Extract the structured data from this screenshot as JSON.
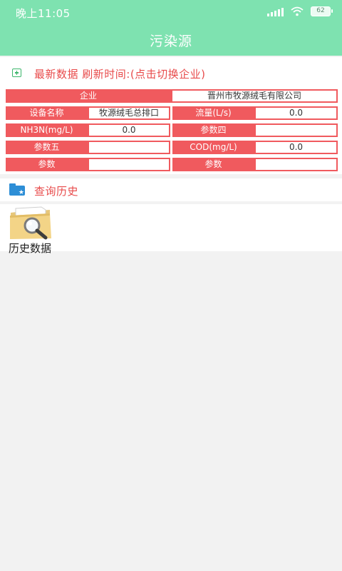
{
  "status_bar": {
    "time": "晚上11:05",
    "battery": "62"
  },
  "header": {
    "title": "污染源"
  },
  "latest": {
    "heading": "最新数据 刷新时间:(点击切换企业)",
    "company_label": "企业",
    "company_value": "晋州市牧源绒毛有限公司",
    "rows": [
      {
        "l1": "设备名称",
        "v1": "牧源绒毛总排口",
        "l2": "流量(L/s)",
        "v2": "0.0"
      },
      {
        "l1": "NH3N(mg/L)",
        "v1": "0.0",
        "l2": "参数四",
        "v2": ""
      },
      {
        "l1": "参数五",
        "v1": "",
        "l2": "COD(mg/L)",
        "v2": "0.0"
      },
      {
        "l1": "参数",
        "v1": "",
        "l2": "参数",
        "v2": ""
      }
    ]
  },
  "history": {
    "heading": "查询历史",
    "items": [
      {
        "label": "历史数据",
        "icon": "folder-search-icon"
      }
    ]
  },
  "colors": {
    "accent": "#7ee2b0",
    "label_red": "#f05a5e",
    "title_red": "#e84b4b"
  }
}
